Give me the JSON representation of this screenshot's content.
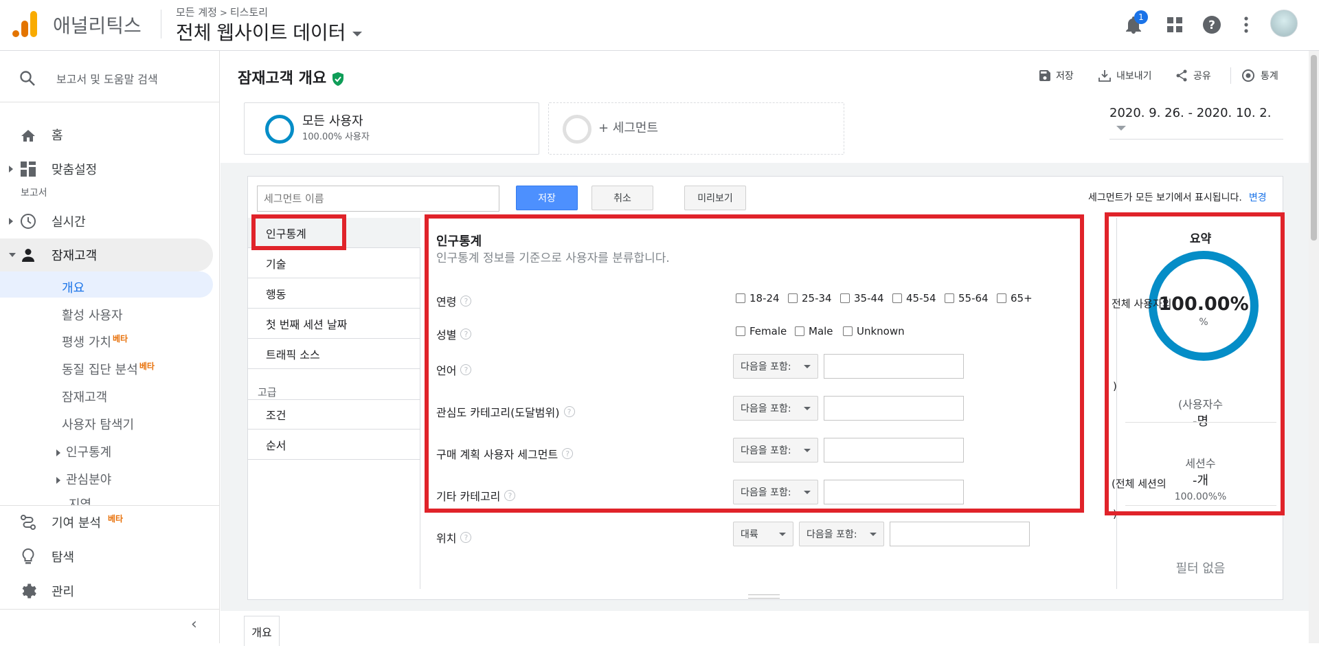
{
  "topbar": {
    "product": "애널리틱스",
    "breadcrumb": {
      "account": "모든 계정",
      "property": "티스토리"
    },
    "view": "전체 웹사이트 데이터",
    "notification_count": "1",
    "icons": [
      "bell-icon",
      "apps-grid-icon",
      "help-icon",
      "more-vert-icon",
      "avatar"
    ]
  },
  "sidebar": {
    "search_placeholder": "보고서 및 도움말 검색",
    "home": "홈",
    "customization": "맞춤설정",
    "section_reports": "보고서",
    "realtime": "실시간",
    "audience": "잠재고객",
    "audience_children": {
      "overview": "개요",
      "active_users": "활성 사용자",
      "lifetime_value": "평생 가치",
      "cohort": "동질 집단 분석",
      "audiences": "잠재고객",
      "user_explorer": "사용자 탐색기",
      "demographics": "인구통계",
      "interests": "관심분야",
      "geo_partial": "지역"
    },
    "beta_tag": "베타",
    "attribution": "기여 분석",
    "discover": "탐색",
    "admin": "관리"
  },
  "header": {
    "title": "잠재고객 개요",
    "actions": {
      "save": "저장",
      "export": "내보내기",
      "share": "공유",
      "insights": "통계"
    },
    "segment_all": {
      "title": "모든 사용자",
      "sub": "100.00% 사용자"
    },
    "segment_add": "+ 세그먼트",
    "date_range": "2020. 9. 26. - 2020. 10. 2."
  },
  "builder": {
    "name_placeholder": "세그먼트 이름",
    "save": "저장",
    "cancel": "취소",
    "preview": "미리보기",
    "visibility_note": "세그먼트가 모든 보기에서 표시됩니다.",
    "visibility_change": "변경",
    "categories": [
      "인구통계",
      "기술",
      "행동",
      "첫 번째 세션 날짜",
      "트래픽 소스"
    ],
    "advanced_label": "고급",
    "advanced": [
      "조건",
      "순서"
    ],
    "panel": {
      "title": "인구통계",
      "subtitle": "인구통계 정보를 기준으로 사용자를 분류합니다.",
      "age_label": "연령",
      "age_options": [
        "18-24",
        "25-34",
        "35-44",
        "45-54",
        "55-64",
        "65+"
      ],
      "gender_label": "성별",
      "gender_options": [
        "Female",
        "Male",
        "Unknown"
      ],
      "language_label": "언어",
      "affinity_label": "관심도 카테고리(도달범위)",
      "in_market_label": "구매 계획 사용자 세그먼트",
      "other_label": "기타 카테고리",
      "location_label": "위치",
      "operator": "다음을 포함:",
      "location_scope": "대륙",
      "help_glyph": "?"
    },
    "summary": {
      "title": "요약",
      "overlay_all_users": "전체 사용자의",
      "pct": "100.00%",
      "pct_unit": "%",
      "users_label": "(사용자수",
      "users_value": "-명",
      "paren": ")",
      "sessions_label": "세션수",
      "sessions_value": "-개",
      "overlay_all_sessions": "(전체 세션의",
      "sessions_pct": "100.00%%",
      "no_filter": "필터 없음"
    }
  },
  "bottom_tab": "개요",
  "colors": {
    "accent": "#058dc7",
    "button_blue": "#4d90fe",
    "highlight_red": "#e0232a",
    "beta_orange": "#e8710a",
    "verified_green": "#0f9d58"
  }
}
